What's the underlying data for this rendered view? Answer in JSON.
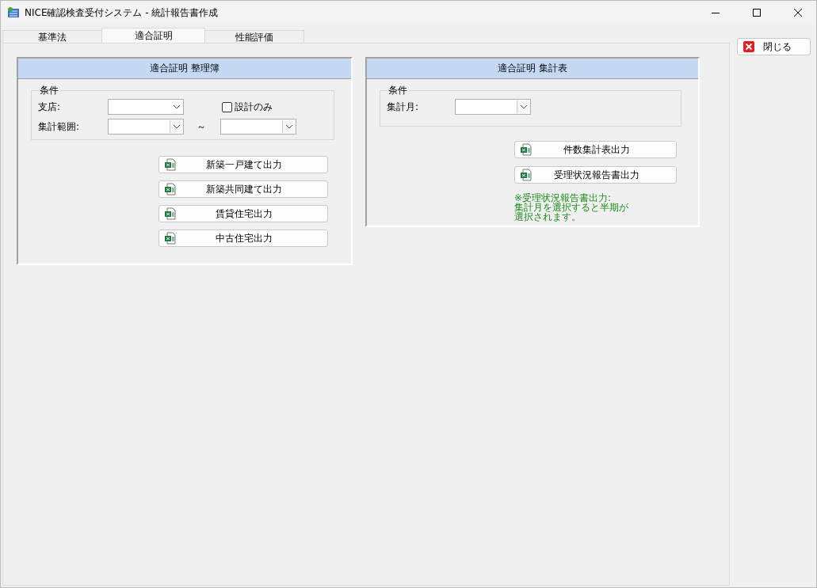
{
  "window": {
    "title": "NICE確認検査受付システム - 統計報告書作成"
  },
  "tabs": [
    {
      "label": "基準法",
      "selected": false
    },
    {
      "label": "適合証明",
      "selected": true
    },
    {
      "label": "性能評価",
      "selected": false
    }
  ],
  "close_button": {
    "label": "閉じる"
  },
  "ledger_panel": {
    "title": "適合証明 整理簿",
    "group_label": "条件",
    "branch": {
      "label": "支店:"
    },
    "design_only": {
      "label": "設計のみ",
      "checked": false
    },
    "range": {
      "label": "集計範囲:",
      "separator": "～"
    },
    "buttons": [
      "新築一戸建て出力",
      "新築共同建て出力",
      "賃貸住宅出力",
      "中古住宅出力"
    ]
  },
  "summary_panel": {
    "title": "適合証明 集計表",
    "group_label": "条件",
    "month": {
      "label": "集計月:"
    },
    "buttons": [
      "件数集計表出力",
      "受理状況報告書出力"
    ],
    "note_lines": [
      "※受理状況報告書出力:",
      "集計月を選択すると半期が",
      "選択されます。"
    ]
  }
}
